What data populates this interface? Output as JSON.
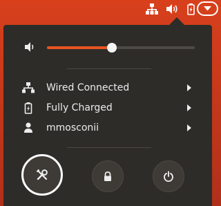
{
  "topbar": {
    "icons": [
      "network-wired-icon",
      "volume-icon",
      "battery-charging-icon",
      "system-menu-arrow-icon"
    ]
  },
  "system_menu": {
    "volume": {
      "icon": "volume-medium-icon",
      "level_percent": 44
    },
    "rows": [
      {
        "icon": "network-wired-icon",
        "label": "Wired Connected",
        "has_submenu": true
      },
      {
        "icon": "battery-full-charged-icon",
        "label": "Fully Charged",
        "has_submenu": true
      },
      {
        "icon": "user-icon",
        "label": "mmosconii",
        "has_submenu": true
      }
    ],
    "buttons": [
      {
        "icon": "settings-icon"
      },
      {
        "icon": "lock-icon"
      },
      {
        "icon": "power-icon"
      }
    ]
  },
  "colors": {
    "accent": "#e95420",
    "menu_bg": "#2e2c29",
    "panel_bg": "#d8401c"
  }
}
